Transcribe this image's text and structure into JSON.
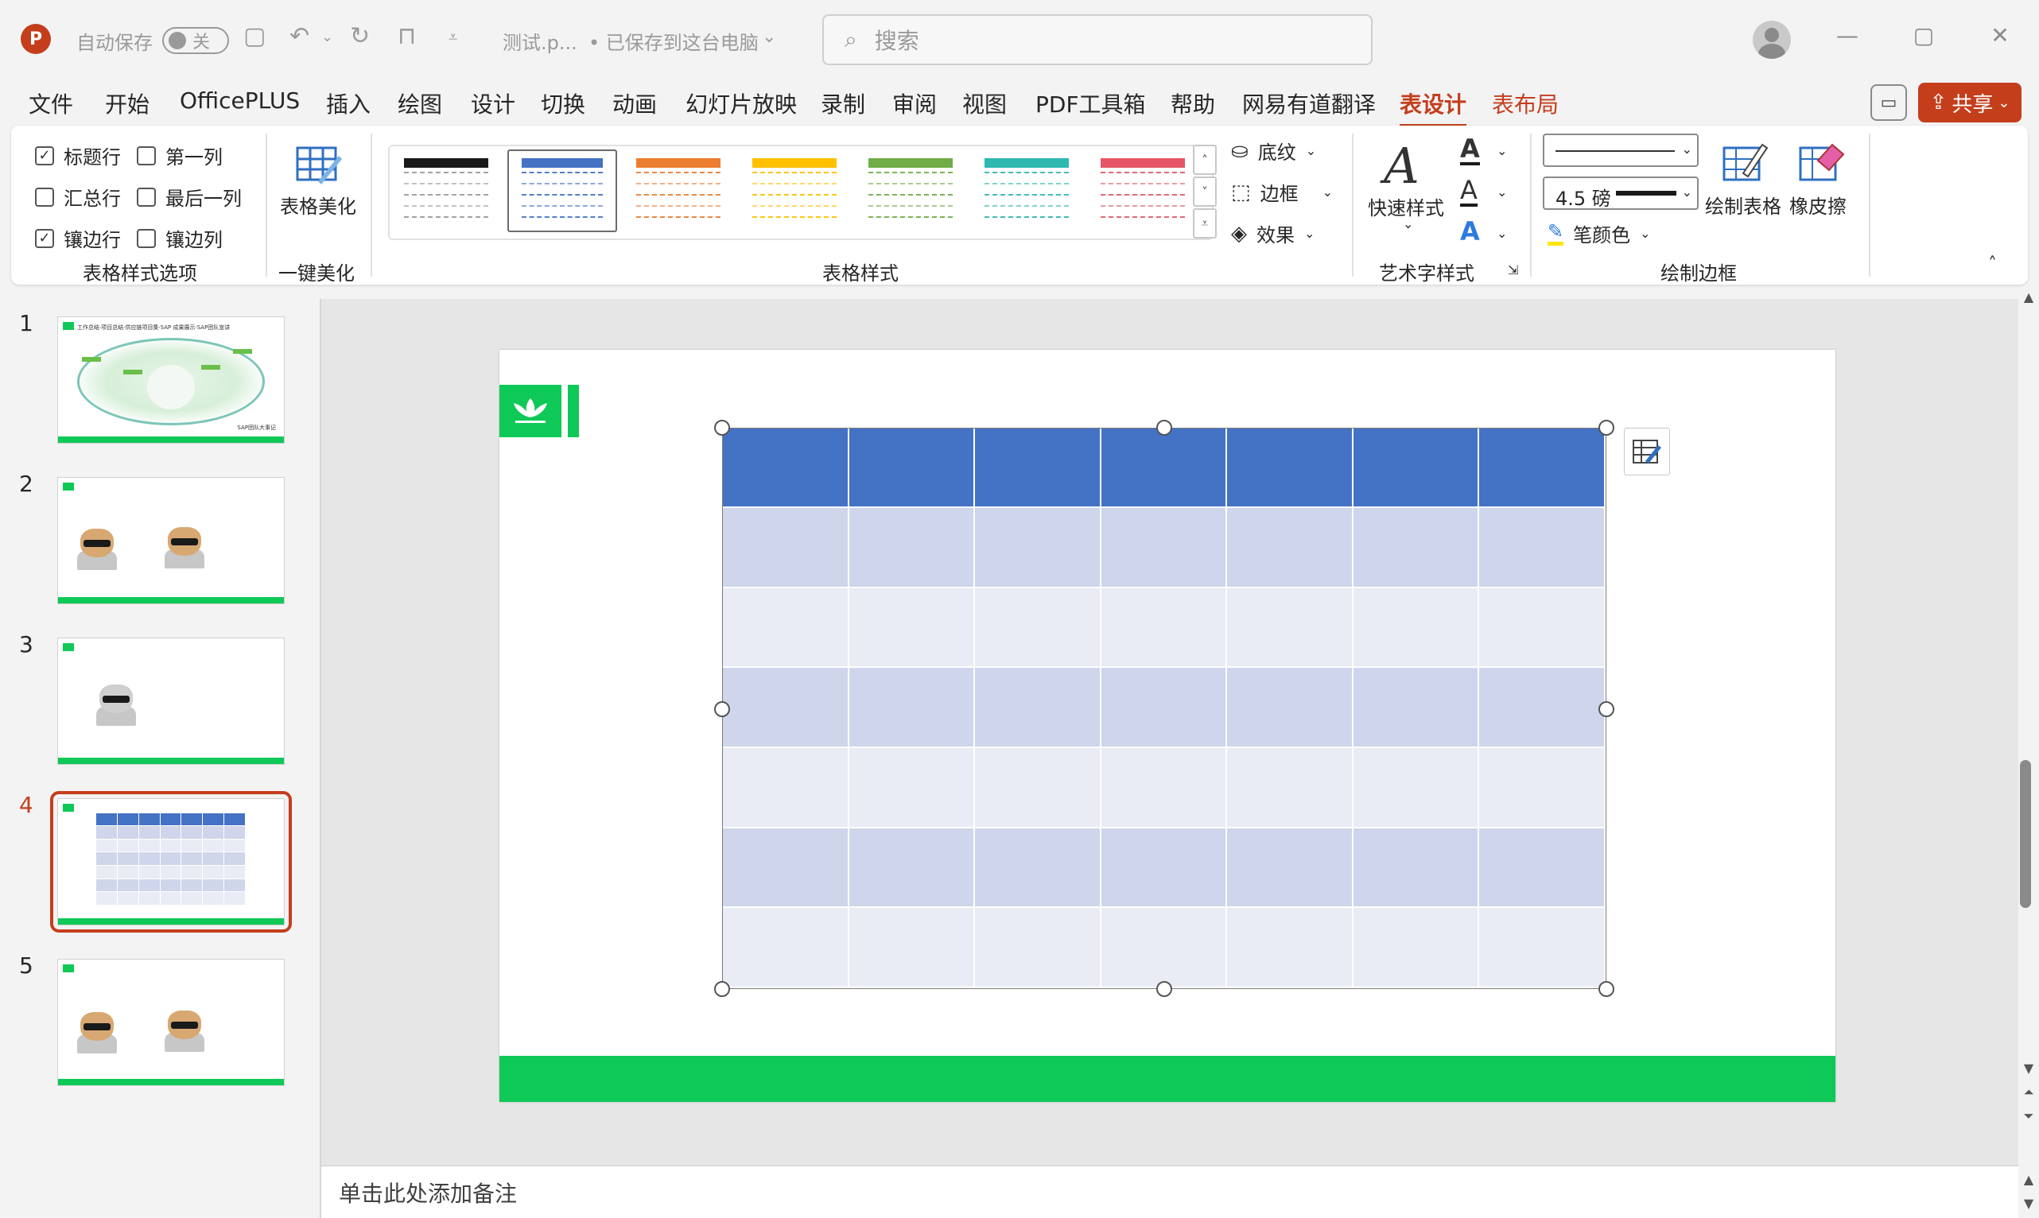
{
  "titlebar": {
    "app_logo": "P",
    "autosave_label": "自动保存",
    "autosave_state": "关",
    "filename": "测试.p...",
    "save_status": "• 已保存到这台电脑",
    "search_placeholder": "搜索"
  },
  "menu": {
    "tabs": [
      "文件",
      "开始",
      "OfficePLUS",
      "插入",
      "绘图",
      "设计",
      "切换",
      "动画",
      "幻灯片放映",
      "录制",
      "审阅",
      "视图",
      "PDF工具箱",
      "帮助",
      "网易有道翻译",
      "表设计",
      "表布局"
    ],
    "active_tab": "表设计",
    "share_label": "共享"
  },
  "ribbon": {
    "table_style_options": {
      "label": "表格样式选项",
      "options": [
        {
          "label": "标题行",
          "checked": true
        },
        {
          "label": "第一列",
          "checked": false
        },
        {
          "label": "汇总行",
          "checked": false
        },
        {
          "label": "最后一列",
          "checked": false
        },
        {
          "label": "镶边行",
          "checked": true
        },
        {
          "label": "镶边列",
          "checked": false
        }
      ]
    },
    "beautify": {
      "button_label": "表格美化",
      "group_label": "一键美化"
    },
    "table_styles": {
      "label": "表格样式",
      "swatch_colors": [
        "#1a1a1a",
        "#4472c4",
        "#ed7d31",
        "#ffc000",
        "#70ad47",
        "#2fb8b0",
        "#e45667"
      ],
      "selected_index": 1
    },
    "shading": {
      "shading_label": "底纹",
      "border_label": "边框",
      "effects_label": "效果"
    },
    "wordart": {
      "quick_styles_label": "快速样式",
      "group_label": "艺术字样式"
    },
    "draw_borders": {
      "pen_weight": "4.5 磅",
      "pen_color_label": "笔颜色",
      "draw_table_label": "绘制表格",
      "eraser_label": "橡皮擦",
      "group_label": "绘制边框"
    }
  },
  "slides": [
    {
      "number": "1",
      "title": "工作总结·项目总结·供应链项目集·SAP 成果展示·SAP团队宣讲",
      "caption": "SAP团队大事记"
    },
    {
      "number": "2"
    },
    {
      "number": "3"
    },
    {
      "number": "4"
    },
    {
      "number": "5"
    }
  ],
  "active_slide_index": 3,
  "notes_placeholder": "单击此处添加备注",
  "colors": {
    "accent": "#c43e1c",
    "table_header": "#4472c4",
    "table_band_dark": "#cfd5ea",
    "table_band_light": "#e9ebf5",
    "slide_green": "#0ec957"
  },
  "table": {
    "columns": 7,
    "rows": 7
  }
}
